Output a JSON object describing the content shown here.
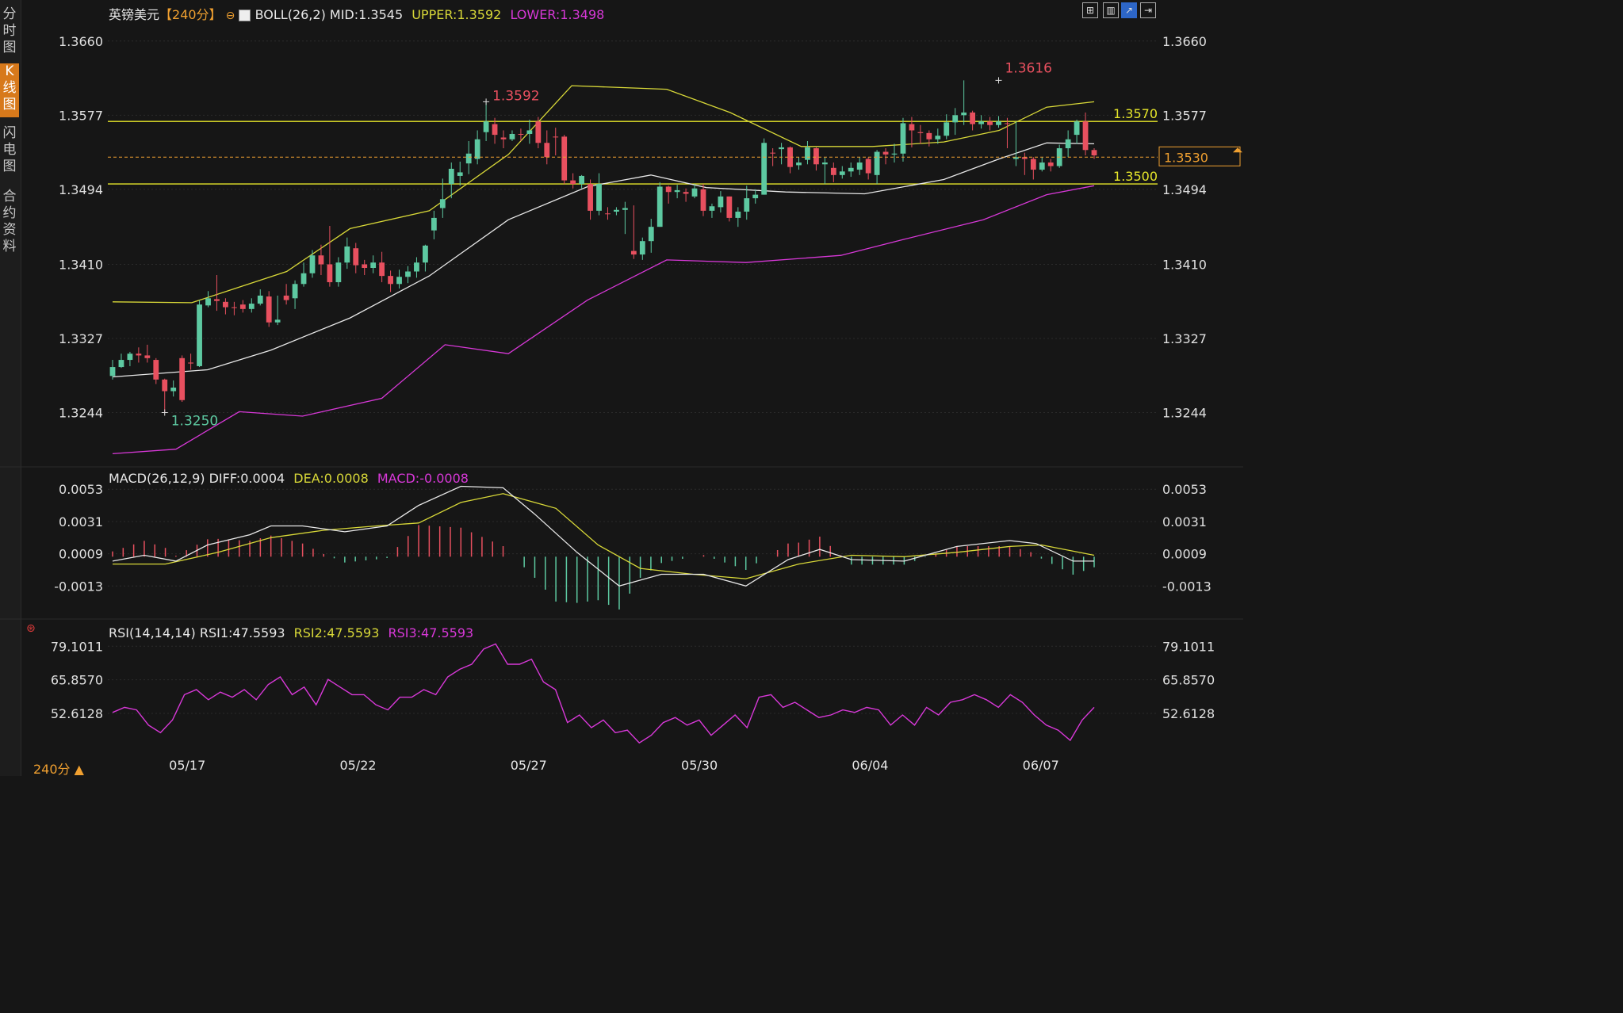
{
  "sidebar": {
    "tabs": [
      "分时图",
      "K线图",
      "闪电图",
      "合约资料"
    ],
    "active": 1
  },
  "header": {
    "symbol": "英镑美元",
    "period": "【240分】",
    "boll_name": "BOLL(26,2)",
    "mid": "MID:1.3545",
    "upper": "UPPER:1.3592",
    "lower": "LOWER:1.3498"
  },
  "toolbar": [
    "grid-icon",
    "candle-icon",
    "chart-icon",
    "expand-icon"
  ],
  "macd_header": {
    "name": "MACD(26,12,9)",
    "diff": "DIFF:0.0004",
    "dea": "DEA:0.0008",
    "macd": "MACD:-0.0008"
  },
  "rsi_header": {
    "name": "RSI(14,14,14)",
    "rsi1": "RSI1:47.5593",
    "rsi2": "RSI2:47.5593",
    "rsi3": "RSI3:47.5593"
  },
  "footer": {
    "period": "240分 ▲"
  },
  "colors": {
    "up": "#e8505f",
    "down": "#5dc9a1",
    "mid": "#e8e8e8",
    "upper": "#d8d838",
    "lower": "#d838d8",
    "price_tag": "#f0a030"
  },
  "chart_data": [
    {
      "type": "candlestick",
      "title": "英镑美元 240分 BOLL(26,2)",
      "y_ticks": [
        "1.3660",
        "1.3577",
        "1.3494",
        "1.3410",
        "1.3327",
        "1.3244"
      ],
      "ylim": [
        1.3193,
        1.369
      ],
      "x_labels": [
        {
          "label": "05/17",
          "index": 7
        },
        {
          "label": "05/22",
          "index": 23
        },
        {
          "label": "05/27",
          "index": 39
        },
        {
          "label": "05/30",
          "index": 55
        },
        {
          "label": "06/04",
          "index": 71
        },
        {
          "label": "06/07",
          "index": 87
        }
      ],
      "candles": [
        [
          1.3295,
          1.3303,
          1.3281,
          1.3285
        ],
        [
          1.3303,
          1.331,
          1.3294,
          1.3295
        ],
        [
          1.331,
          1.3312,
          1.3296,
          1.3303
        ],
        [
          1.3308,
          1.3317,
          1.33,
          1.331
        ],
        [
          1.3305,
          1.332,
          1.33,
          1.3308
        ],
        [
          1.3281,
          1.3305,
          1.3276,
          1.3303
        ],
        [
          1.3268,
          1.3282,
          1.3244,
          1.3281
        ],
        [
          1.3272,
          1.328,
          1.3262,
          1.3268
        ],
        [
          1.3258,
          1.3308,
          1.3256,
          1.3305
        ],
        [
          1.3299,
          1.331,
          1.3292,
          1.33
        ],
        [
          1.3365,
          1.337,
          1.3295,
          1.3296
        ],
        [
          1.3372,
          1.338,
          1.3362,
          1.3364
        ],
        [
          1.3369,
          1.3398,
          1.3358,
          1.3371
        ],
        [
          1.3362,
          1.3372,
          1.3354,
          1.3368
        ],
        [
          1.3362,
          1.3368,
          1.3353,
          1.3362
        ],
        [
          1.336,
          1.337,
          1.3356,
          1.3365
        ],
        [
          1.3366,
          1.3372,
          1.3356,
          1.336
        ],
        [
          1.3375,
          1.3382,
          1.3364,
          1.3366
        ],
        [
          1.3345,
          1.338,
          1.334,
          1.3374
        ],
        [
          1.3348,
          1.3375,
          1.3342,
          1.3345
        ],
        [
          1.337,
          1.3388,
          1.3365,
          1.3375
        ],
        [
          1.3388,
          1.3392,
          1.336,
          1.3372
        ],
        [
          1.34,
          1.3412,
          1.3385,
          1.3388
        ],
        [
          1.342,
          1.3426,
          1.3395,
          1.34
        ],
        [
          1.341,
          1.3432,
          1.3398,
          1.342
        ],
        [
          1.339,
          1.3453,
          1.3385,
          1.341
        ],
        [
          1.3412,
          1.3418,
          1.3385,
          1.339
        ],
        [
          1.343,
          1.344,
          1.3405,
          1.3412
        ],
        [
          1.3409,
          1.3434,
          1.34,
          1.3428
        ],
        [
          1.3406,
          1.3415,
          1.3398,
          1.341
        ],
        [
          1.3412,
          1.342,
          1.34,
          1.3406
        ],
        [
          1.3397,
          1.3424,
          1.339,
          1.3412
        ],
        [
          1.3388,
          1.3403,
          1.3379,
          1.3397
        ],
        [
          1.3396,
          1.3404,
          1.3383,
          1.3388
        ],
        [
          1.3402,
          1.3408,
          1.3389,
          1.3396
        ],
        [
          1.3412,
          1.3418,
          1.3395,
          1.3402
        ],
        [
          1.3431,
          1.3432,
          1.3402,
          1.3412
        ],
        [
          1.3462,
          1.347,
          1.3438,
          1.3448
        ],
        [
          1.3483,
          1.3506,
          1.3462,
          1.3473
        ],
        [
          1.3517,
          1.3524,
          1.3484,
          1.35
        ],
        [
          1.3513,
          1.3525,
          1.3498,
          1.3509
        ],
        [
          1.3534,
          1.3548,
          1.3511,
          1.3523
        ],
        [
          1.355,
          1.356,
          1.3522,
          1.3528
        ],
        [
          1.357,
          1.3592,
          1.3548,
          1.3558
        ],
        [
          1.3555,
          1.3574,
          1.3545,
          1.3567
        ],
        [
          1.355,
          1.356,
          1.354,
          1.3552
        ],
        [
          1.3556,
          1.356,
          1.3548,
          1.355
        ],
        [
          1.3556,
          1.3562,
          1.3548,
          1.3556
        ],
        [
          1.356,
          1.3572,
          1.3545,
          1.3556
        ],
        [
          1.3546,
          1.3575,
          1.354,
          1.357
        ],
        [
          1.353,
          1.356,
          1.3522,
          1.3546
        ],
        [
          1.3553,
          1.3563,
          1.3532,
          1.3553
        ],
        [
          1.3504,
          1.3555,
          1.35,
          1.3553
        ],
        [
          1.35,
          1.3512,
          1.3495,
          1.3504
        ],
        [
          1.3509,
          1.351,
          1.3495,
          1.35
        ],
        [
          1.347,
          1.3505,
          1.346,
          1.35
        ],
        [
          1.35,
          1.3512,
          1.3465,
          1.347
        ],
        [
          1.3467,
          1.3474,
          1.346,
          1.3467
        ],
        [
          1.3471,
          1.3474,
          1.3465,
          1.3469
        ],
        [
          1.3473,
          1.348,
          1.3444,
          1.3471
        ],
        [
          1.3421,
          1.3476,
          1.3416,
          1.3425
        ],
        [
          1.3436,
          1.344,
          1.3415,
          1.3421
        ],
        [
          1.3452,
          1.3461,
          1.3423,
          1.3436
        ],
        [
          1.3497,
          1.3502,
          1.3452,
          1.3452
        ],
        [
          1.3491,
          1.3498,
          1.3478,
          1.3497
        ],
        [
          1.3493,
          1.3499,
          1.3484,
          1.3491
        ],
        [
          1.3489,
          1.3495,
          1.348,
          1.3491
        ],
        [
          1.3495,
          1.35,
          1.3484,
          1.3486
        ],
        [
          1.347,
          1.35,
          1.3464,
          1.3494
        ],
        [
          1.3475,
          1.3478,
          1.3462,
          1.347
        ],
        [
          1.3486,
          1.3492,
          1.3468,
          1.3474
        ],
        [
          1.3462,
          1.3486,
          1.3458,
          1.3486
        ],
        [
          1.3469,
          1.3474,
          1.3452,
          1.3462
        ],
        [
          1.3484,
          1.3498,
          1.346,
          1.3469
        ],
        [
          1.3488,
          1.3494,
          1.3478,
          1.3484
        ],
        [
          1.3546,
          1.3551,
          1.3488,
          1.3488
        ],
        [
          1.3535,
          1.354,
          1.352,
          1.3535
        ],
        [
          1.3541,
          1.3546,
          1.3522,
          1.3539
        ],
        [
          1.3519,
          1.3542,
          1.3512,
          1.3541
        ],
        [
          1.3524,
          1.353,
          1.3516,
          1.3521
        ],
        [
          1.3541,
          1.3548,
          1.3522,
          1.3527
        ],
        [
          1.3522,
          1.3541,
          1.3515,
          1.354
        ],
        [
          1.3524,
          1.353,
          1.35,
          1.3522
        ],
        [
          1.351,
          1.3524,
          1.3502,
          1.3518
        ],
        [
          1.3514,
          1.352,
          1.3506,
          1.351
        ],
        [
          1.3518,
          1.3524,
          1.3508,
          1.3514
        ],
        [
          1.3524,
          1.353,
          1.351,
          1.3516
        ],
        [
          1.3512,
          1.353,
          1.3505,
          1.3528
        ],
        [
          1.3536,
          1.3538,
          1.35,
          1.351
        ],
        [
          1.3533,
          1.354,
          1.3522,
          1.3536
        ],
        [
          1.3534,
          1.3545,
          1.3524,
          1.3533
        ],
        [
          1.3568,
          1.3574,
          1.3525,
          1.3534
        ],
        [
          1.356,
          1.3575,
          1.3541,
          1.3567
        ],
        [
          1.3557,
          1.3566,
          1.3545,
          1.3558
        ],
        [
          1.355,
          1.356,
          1.3542,
          1.3557
        ],
        [
          1.3554,
          1.3562,
          1.3545,
          1.355
        ],
        [
          1.3569,
          1.3578,
          1.355,
          1.3554
        ],
        [
          1.3577,
          1.3585,
          1.3555,
          1.3569
        ],
        [
          1.358,
          1.3616,
          1.3566,
          1.3577
        ],
        [
          1.3567,
          1.3582,
          1.356,
          1.358
        ],
        [
          1.357,
          1.3577,
          1.3562,
          1.3567
        ],
        [
          1.3566,
          1.3575,
          1.356,
          1.357
        ],
        [
          1.357,
          1.3576,
          1.3563,
          1.3566
        ],
        [
          1.3568,
          1.3574,
          1.354,
          1.3568
        ],
        [
          1.353,
          1.357,
          1.352,
          1.3528
        ],
        [
          1.3528,
          1.3535,
          1.351,
          1.353
        ],
        [
          1.3516,
          1.353,
          1.3505,
          1.3528
        ],
        [
          1.3524,
          1.353,
          1.3514,
          1.3516
        ],
        [
          1.352,
          1.3528,
          1.3514,
          1.3524
        ],
        [
          1.354,
          1.3544,
          1.3518,
          1.352
        ],
        [
          1.355,
          1.356,
          1.353,
          1.354
        ],
        [
          1.357,
          1.3572,
          1.3545,
          1.3555
        ],
        [
          1.3538,
          1.358,
          1.3532,
          1.357
        ],
        [
          1.3532,
          1.354,
          1.3528,
          1.3538
        ]
      ],
      "boll_mid": [
        [
          0,
          1.3284
        ],
        [
          12,
          1.3292
        ],
        [
          20,
          1.3314
        ],
        [
          30,
          1.335
        ],
        [
          40,
          1.3397
        ],
        [
          50,
          1.346
        ],
        [
          60,
          1.3497
        ],
        [
          68,
          1.351
        ],
        [
          75,
          1.3496
        ],
        [
          85,
          1.3491
        ],
        [
          95,
          1.3489
        ],
        [
          105,
          1.3505
        ],
        [
          112,
          1.3528
        ],
        [
          118,
          1.3546
        ],
        [
          124,
          1.3545
        ]
      ],
      "boll_upper": [
        [
          0,
          1.3368
        ],
        [
          10,
          1.3367
        ],
        [
          22,
          1.3402
        ],
        [
          30,
          1.345
        ],
        [
          40,
          1.347
        ],
        [
          50,
          1.3533
        ],
        [
          58,
          1.361
        ],
        [
          70,
          1.3606
        ],
        [
          78,
          1.358
        ],
        [
          87,
          1.3542
        ],
        [
          96,
          1.3542
        ],
        [
          105,
          1.3547
        ],
        [
          112,
          1.356
        ],
        [
          118,
          1.3586
        ],
        [
          124,
          1.3592
        ]
      ],
      "boll_lower": [
        [
          0,
          1.3198
        ],
        [
          8,
          1.3203
        ],
        [
          16,
          1.3245
        ],
        [
          24,
          1.324
        ],
        [
          34,
          1.326
        ],
        [
          42,
          1.332
        ],
        [
          50,
          1.331
        ],
        [
          60,
          1.337
        ],
        [
          70,
          1.3415
        ],
        [
          80,
          1.3412
        ],
        [
          92,
          1.342
        ],
        [
          100,
          1.3438
        ],
        [
          110,
          1.346
        ],
        [
          118,
          1.3488
        ],
        [
          124,
          1.3498
        ]
      ],
      "annotations": [
        {
          "text": "1.3592",
          "value": 1.3592,
          "index": 43
        },
        {
          "text": "1.3616",
          "value": 1.3616,
          "index": 102
        },
        {
          "text": "1.3250",
          "value": 1.3244,
          "index": 6
        }
      ],
      "level_lines": [
        {
          "label": "1.3570",
          "value": 1.357
        },
        {
          "label": "1.3500",
          "value": 1.35
        }
      ],
      "last_price": {
        "label": "1.3530",
        "value": 1.353
      }
    },
    {
      "type": "bar+line",
      "title": "MACD(26,12,9)",
      "y_ticks": [
        "0.0053",
        "0.0031",
        "0.0009",
        "-0.0013"
      ],
      "ylim": [
        -0.0035,
        0.0058
      ],
      "diff": [
        [
          0,
          0.0004
        ],
        [
          6,
          0.0008
        ],
        [
          12,
          0.0004
        ],
        [
          18,
          0.0015
        ],
        [
          26,
          0.0022
        ],
        [
          30,
          0.0028
        ],
        [
          36,
          0.0028
        ],
        [
          44,
          0.0024
        ],
        [
          52,
          0.0028
        ],
        [
          58,
          0.0042
        ],
        [
          66,
          0.0055
        ],
        [
          74,
          0.0054
        ],
        [
          80,
          0.0036
        ],
        [
          88,
          0.001
        ],
        [
          96,
          -0.0013
        ],
        [
          104,
          -0.0005
        ],
        [
          112,
          -0.0005
        ],
        [
          120,
          -0.0013
        ],
        [
          128,
          0.0005
        ],
        [
          134,
          0.0012
        ],
        [
          140,
          0.0005
        ],
        [
          150,
          0.0004
        ],
        [
          160,
          0.0014
        ],
        [
          170,
          0.0018
        ],
        [
          175,
          0.0016
        ],
        [
          182,
          0.0004
        ],
        [
          186,
          0.0004
        ]
      ],
      "dea": [
        [
          0,
          0.0002
        ],
        [
          10,
          0.0002
        ],
        [
          20,
          0.001
        ],
        [
          30,
          0.002
        ],
        [
          40,
          0.0025
        ],
        [
          50,
          0.0028
        ],
        [
          58,
          0.003
        ],
        [
          66,
          0.0044
        ],
        [
          74,
          0.005
        ],
        [
          84,
          0.004
        ],
        [
          92,
          0.0015
        ],
        [
          100,
          -0.0001
        ],
        [
          110,
          -0.0005
        ],
        [
          120,
          -0.0008
        ],
        [
          130,
          0.0002
        ],
        [
          140,
          0.0008
        ],
        [
          150,
          0.0007
        ],
        [
          160,
          0.001
        ],
        [
          170,
          0.0014
        ],
        [
          176,
          0.0015
        ],
        [
          186,
          0.0008
        ]
      ]
    },
    {
      "type": "line",
      "title": "RSI(14,14,14)",
      "y_ticks": [
        "79.1011",
        "65.8570",
        "52.6128"
      ],
      "ylim": [
        37.0,
        82.0
      ],
      "rsi": [
        53,
        55,
        54,
        48,
        45,
        50,
        60,
        62,
        58,
        61,
        59,
        62,
        58,
        64,
        67,
        60,
        63,
        56,
        66,
        63,
        60,
        60,
        56,
        54,
        59,
        59,
        62,
        60,
        67,
        70,
        72,
        78,
        80,
        72,
        72,
        74,
        65,
        62,
        49,
        52,
        47,
        50,
        45,
        46,
        41,
        44,
        49,
        51,
        48,
        50,
        44,
        48,
        52,
        47,
        59,
        60,
        55,
        57,
        54,
        51,
        52,
        54,
        53,
        55,
        54,
        48,
        52,
        48,
        55,
        52,
        57,
        58,
        60,
        58,
        55,
        60,
        57,
        52,
        48,
        46,
        42,
        50,
        55
      ]
    }
  ]
}
